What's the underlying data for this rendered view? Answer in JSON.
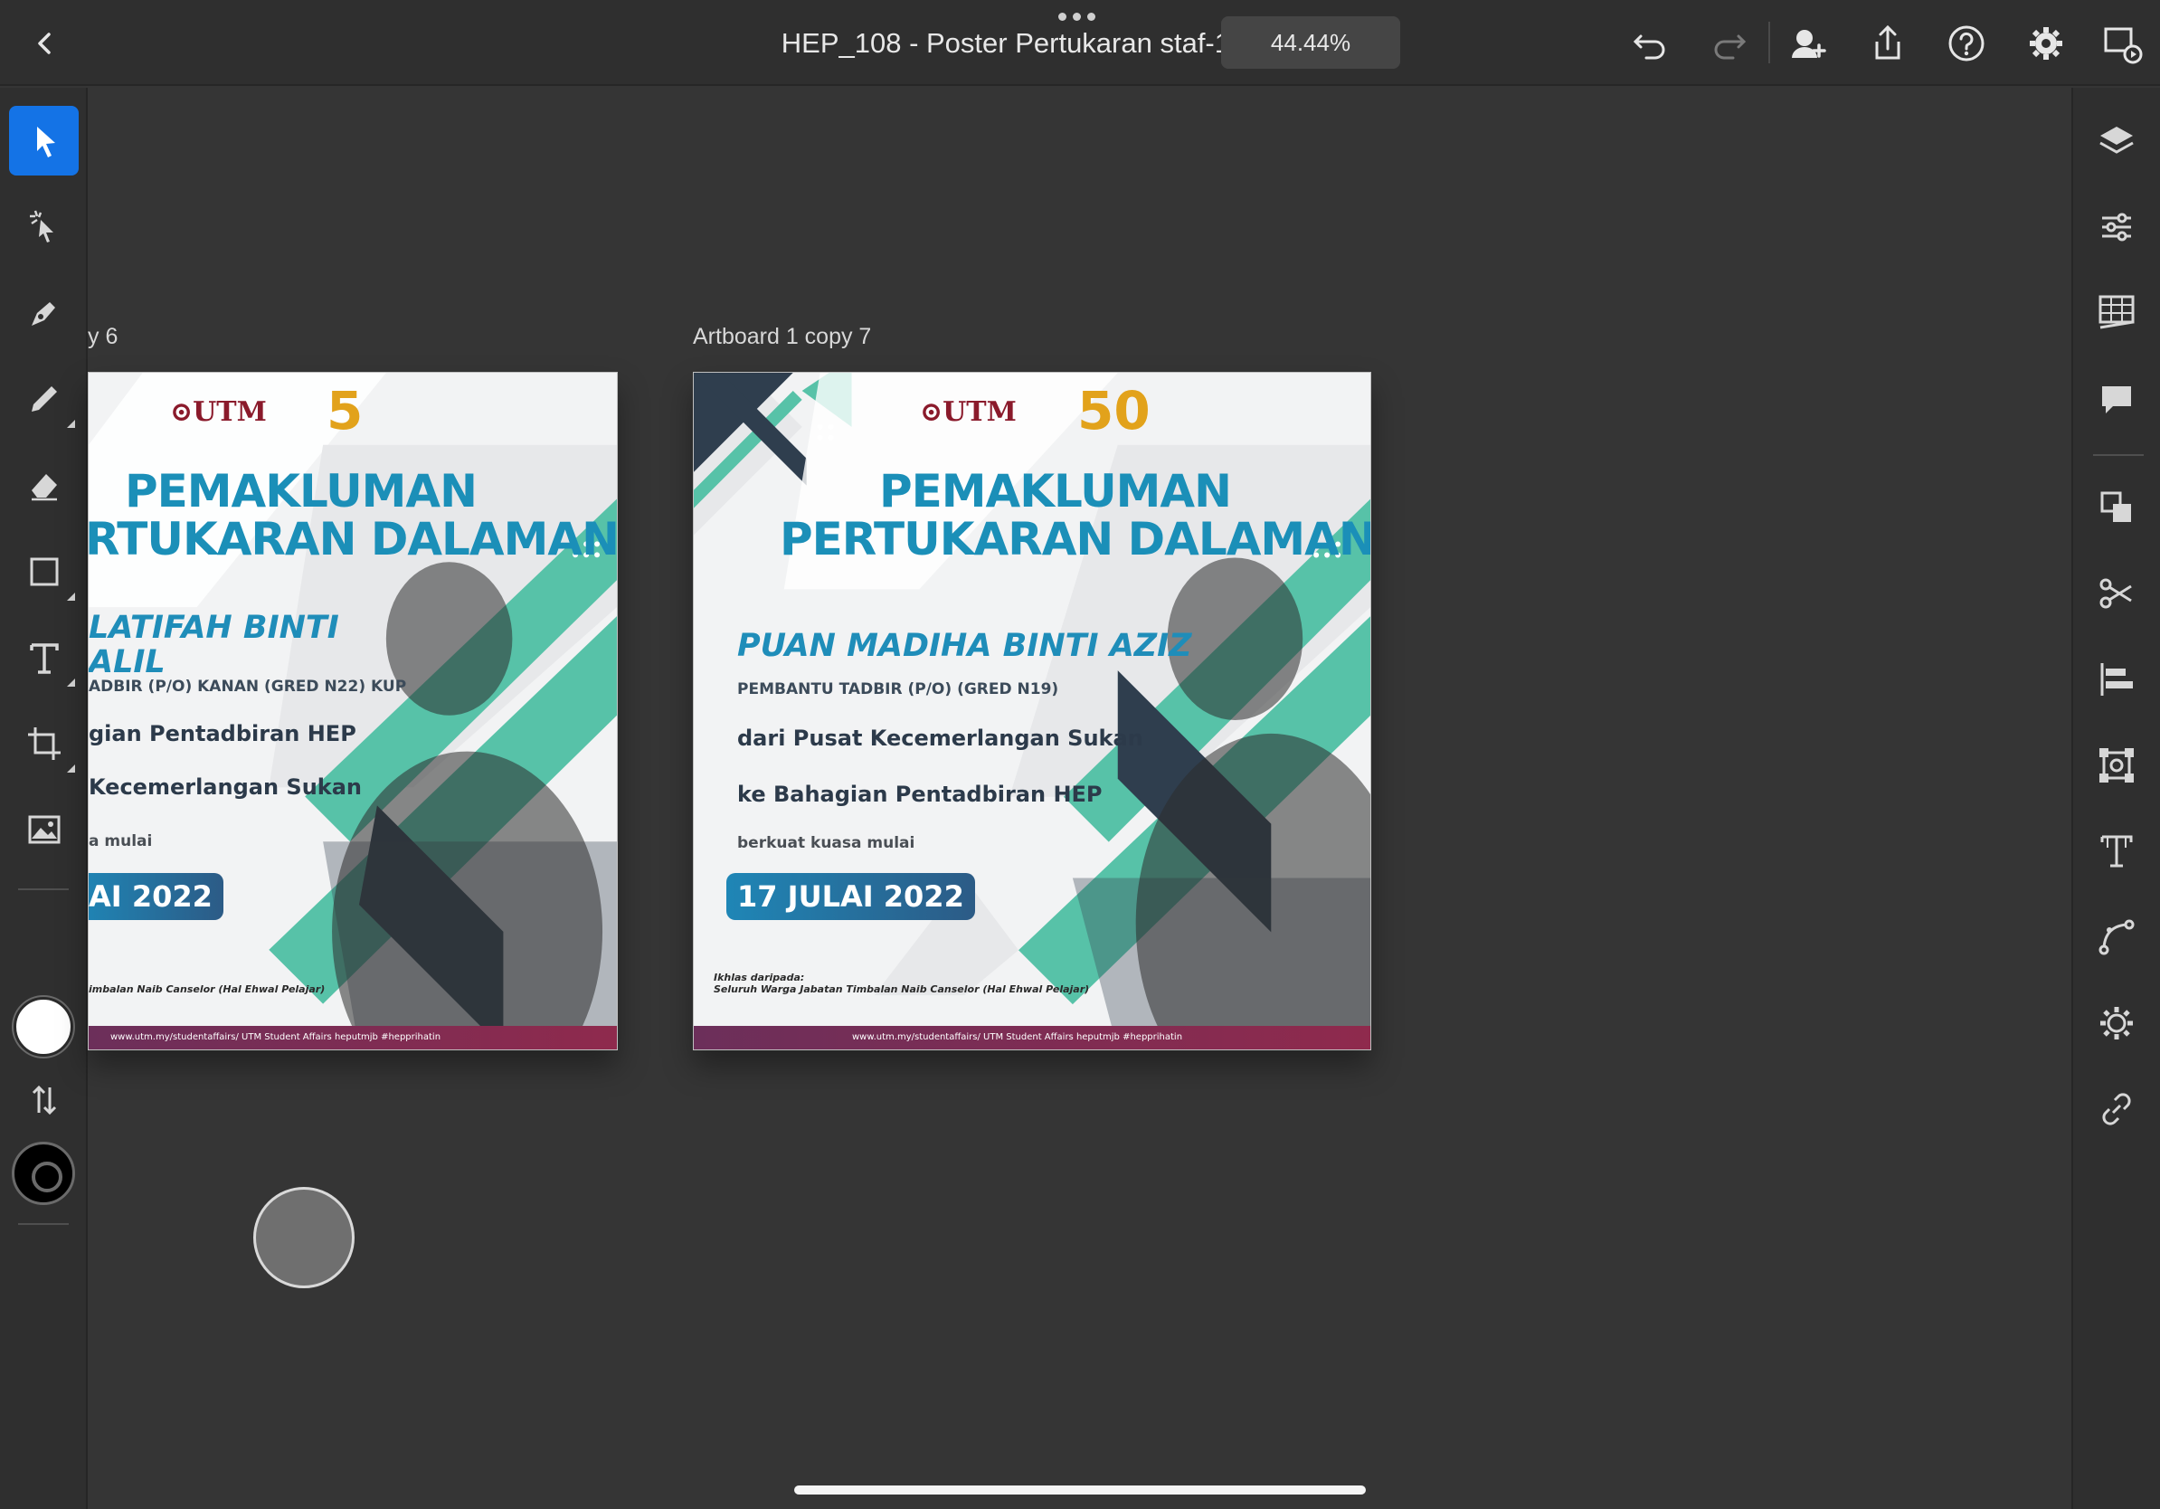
{
  "topbar": {
    "doc_title": "HEP_108 - Poster Pertukaran staf-1",
    "zoom": "44.44%",
    "icons": [
      "back-icon",
      "undo-icon",
      "redo-icon",
      "add-user-icon",
      "share-icon",
      "help-icon",
      "settings-icon",
      "prototype-icon"
    ]
  },
  "tools": {
    "left": [
      "select-icon",
      "direct-select-icon",
      "pen-icon",
      "pencil-icon",
      "eraser-icon",
      "rectangle-icon",
      "text-icon",
      "crop-icon",
      "image-icon"
    ],
    "right": [
      "layers-icon",
      "properties-icon",
      "grid-icon",
      "comments-icon",
      "arrange-icon",
      "cut-icon",
      "align-icon",
      "transform-icon",
      "type-icon",
      "path-icon",
      "effects-icon",
      "link-icon"
    ]
  },
  "artboards": {
    "left": {
      "label": "y 6",
      "heading1": "PEMAKLUMAN",
      "heading2": "RTUKARAN DALAMAN",
      "name1": "LATIFAH BINTI",
      "name2": "ALIL",
      "position": "ADBIR (P/O) KANAN (GRED N22) KUP",
      "line1": "gian Pentadbiran HEP",
      "line2": "Kecemerlangan Sukan",
      "effective": "a mulai",
      "date": "AI 2022",
      "from": "imbalan Naib Canselor (Hal Ehwal Pelajar)",
      "footer": "www.utm.my/studentaffairs/   UTM Student Affairs   heputmjb   #hepprihatin"
    },
    "right": {
      "label": "Artboard 1 copy 7",
      "logo_text": "UTM",
      "logo_50": "50",
      "heading1": "PEMAKLUMAN",
      "heading2": "PERTUKARAN DALAMAN",
      "name": "PUAN MADIHA BINTI AZIZ",
      "position": "PEMBANTU TADBIR (P/O) (GRED N19)",
      "line1": "dari Pusat Kecemerlangan Sukan",
      "line2": "ke Bahagian Pentadbiran HEP",
      "effective": "berkuat kuasa mulai",
      "date": "17 JULAI 2022",
      "ikhlas": "Ikhlas daripada:",
      "from": "Seluruh Warga Jabatan Timbalan Naib Canselor (Hal Ehwal Pelajar)",
      "footer": "www.utm.my/studentaffairs/   UTM Student Affairs   heputmjb   #hepprihatin"
    }
  },
  "colors": {
    "accent": "#1473e6",
    "teal": "#57c2a8",
    "navy": "#2f3e4e",
    "heading_blue": "#1b8fb8",
    "footer_magenta": "#8f2a4d"
  }
}
